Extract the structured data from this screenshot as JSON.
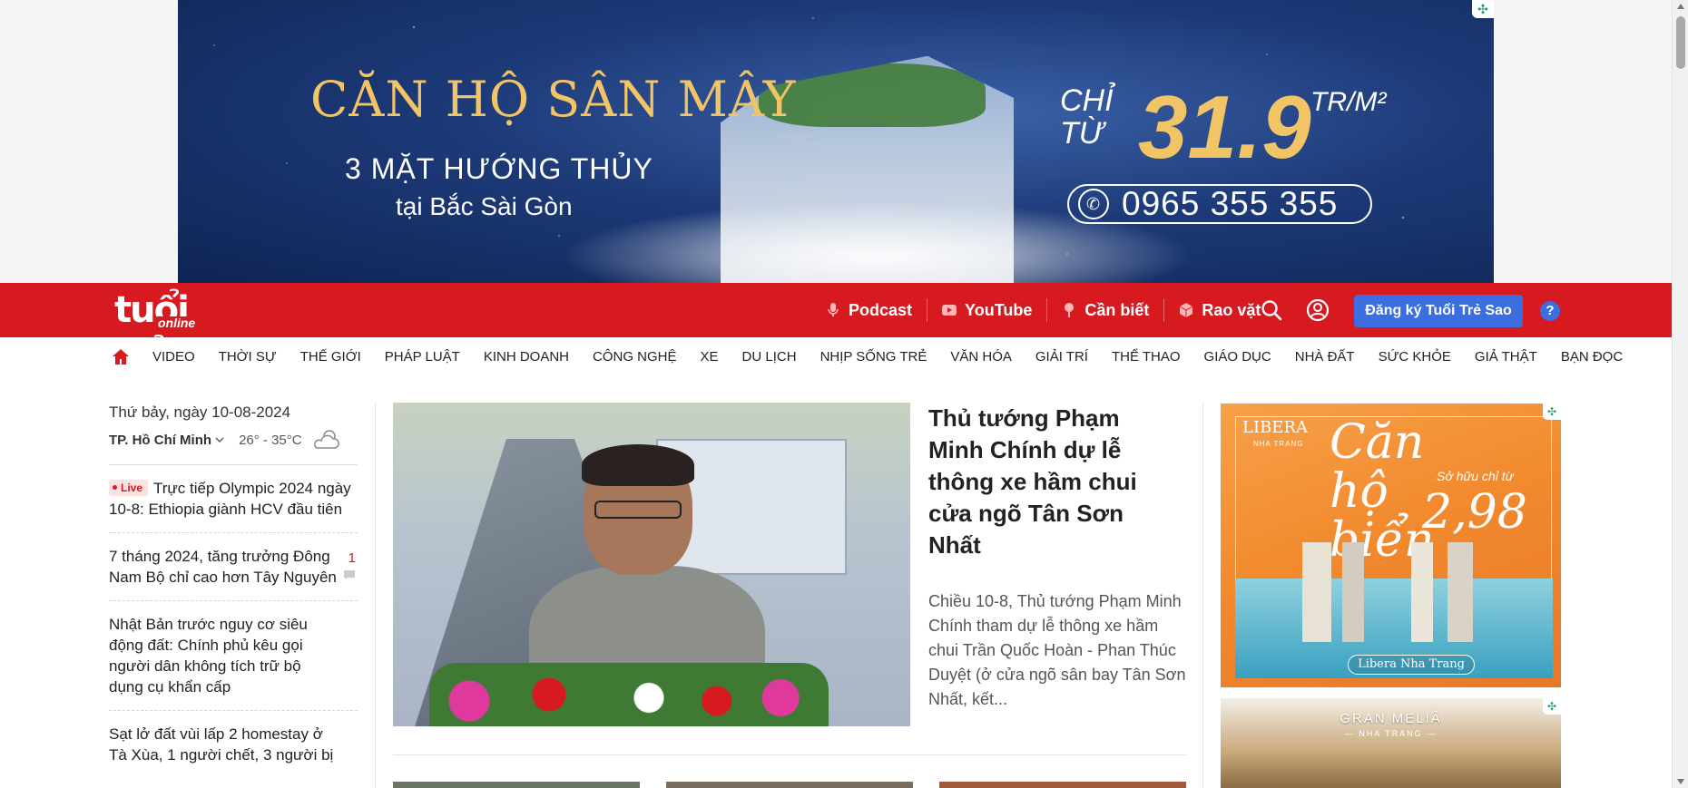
{
  "top_ad": {
    "title": "CĂN HỘ SÂN MÂY",
    "subtitle1": "3 MẶT HƯỚNG THỦY",
    "subtitle2": "tại Bắc Sài Gòn",
    "chi_tu": "CHỈ\nTỪ",
    "price": "31.9",
    "unit": "TR/M²",
    "phone": "0965 355 355"
  },
  "header": {
    "logo_main": "tuổi trẻ",
    "logo_sub": "online",
    "links": [
      {
        "label": "Podcast",
        "icon": "microphone-icon"
      },
      {
        "label": "YouTube",
        "icon": "youtube-icon"
      },
      {
        "label": "Cần biết",
        "icon": "pin-icon"
      },
      {
        "label": "Rao vặt",
        "icon": "box-icon"
      }
    ],
    "signup_label": "Đăng ký Tuổi Trẻ Sao",
    "help_label": "?"
  },
  "categories": [
    "VIDEO",
    "THỜI SỰ",
    "THẾ GIỚI",
    "PHÁP LUẬT",
    "KINH DOANH",
    "CÔNG NGHỆ",
    "XE",
    "DU LỊCH",
    "NHỊP SỐNG TRẺ",
    "VĂN HÓA",
    "GIẢI TRÍ",
    "THỂ THAO",
    "GIÁO DỤC",
    "NHÀ ĐẤT",
    "SỨC KHỎE",
    "GIẢ THẬT",
    "BẠN ĐỌC"
  ],
  "sidebar": {
    "date": "Thứ bảy, ngày 10-08-2024",
    "city": "TP. Hồ Chí Minh",
    "temperature": "26° - 35°C",
    "live_label": "Live",
    "news": [
      {
        "title": "Trực tiếp Olympic 2024 ngày 10-8: Ethiopia giành HCV đầu tiên",
        "live": true
      },
      {
        "title": "7 tháng 2024, tăng trưởng Đông Nam Bộ chỉ cao hơn Tây Nguyên",
        "comments": "1"
      },
      {
        "title": "Nhật Bản trước nguy cơ siêu động đất: Chính phủ kêu gọi người dân không tích trữ bộ dụng cụ khẩn cấp"
      },
      {
        "title": "Sạt lở đất vùi lấp 2 homestay ở Tà Xùa, 1 người chết, 3 người bị"
      }
    ]
  },
  "hero": {
    "title": "Thủ tướng Phạm Minh Chính dự lễ thông xe hầm chui cửa ngõ Tân Sơn Nhất",
    "summary": "Chiều 10-8, Thủ tướng Phạm Minh Chính tham dự lễ thông xe hầm chui Trần Quốc Hoàn - Phan Thúc Duyệt (ở cửa ngõ sân bay Tân Sơn Nhất, kết..."
  },
  "right_ads": {
    "ad1_brand": "LIBERA",
    "ad1_brand_sub": "NHA TRANG",
    "ad1_big": "Căn hộ biển",
    "ad1_sohuu": "Sở hữu chỉ từ",
    "ad1_price": "2,98",
    "ad1_label": "Libera Nha Trang",
    "ad2_title": "GRAN MELIÃ",
    "ad2_sub": "— NHA TRANG —"
  },
  "colors": {
    "brand_red": "#d71920",
    "signup_blue": "#3b6fe0"
  }
}
